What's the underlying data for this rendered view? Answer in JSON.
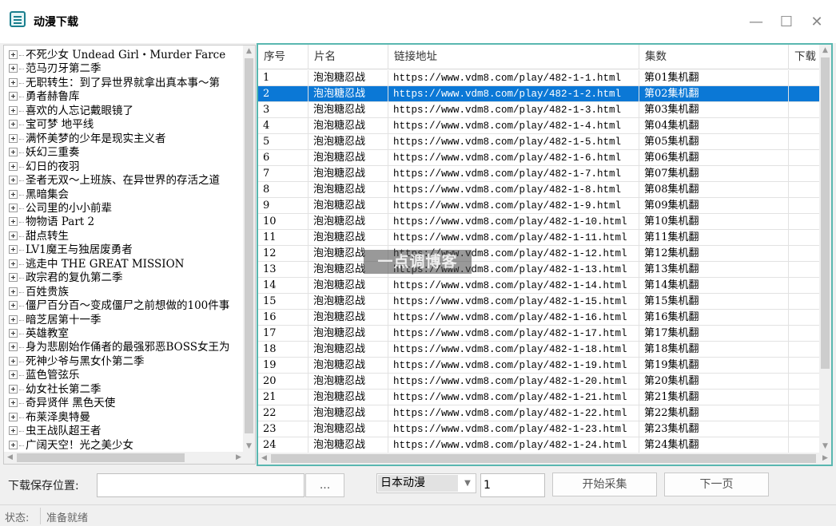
{
  "window": {
    "title": "动漫下载",
    "minimize": "—",
    "maximize": "☐",
    "close": "✕"
  },
  "tree": {
    "items": [
      "不死少女 Undead Girl・Murder Farce",
      "范马刃牙第二季",
      "无职转生：到了异世界就拿出真本事～第",
      "勇者赫鲁库",
      "喜欢的人忘记戴眼镜了",
      "宝可梦 地平线",
      "满怀美梦的少年是现实主义者",
      "妖幻三重奏",
      "幻日的夜羽",
      "圣者无双～上班族、在异世界的存活之道",
      "黑暗集会",
      "公司里的小小前辈",
      "物物语 Part 2",
      "甜点转生",
      "LV1魔王与独居废勇者",
      "逃走中 THE GREAT MISSION",
      "政宗君的复仇第二季",
      "百姓贵族",
      "僵尸百分百～变成僵尸之前想做的100件事",
      "暗芝居第十一季",
      "英雄教室",
      "身为悲剧始作俑者的最强邪恶BOSS女王为",
      "死神少爷与黑女仆第二季",
      "蓝色管弦乐",
      "幼女社长第二季",
      "奇异贤伴 黑色天使",
      "布莱泽奥特曼",
      "虫王战队超王者",
      "广阔天空！光之美少女"
    ]
  },
  "grid": {
    "headers": [
      "序号",
      "片名",
      "链接地址",
      "集数",
      "下载"
    ],
    "selected_index": 1,
    "rows": [
      [
        "1",
        "泡泡糖忍战",
        "https://www.vdm8.com/play/482-1-1.html",
        "第01集机翻",
        ""
      ],
      [
        "2",
        "泡泡糖忍战",
        "https://www.vdm8.com/play/482-1-2.html",
        "第02集机翻",
        ""
      ],
      [
        "3",
        "泡泡糖忍战",
        "https://www.vdm8.com/play/482-1-3.html",
        "第03集机翻",
        ""
      ],
      [
        "4",
        "泡泡糖忍战",
        "https://www.vdm8.com/play/482-1-4.html",
        "第04集机翻",
        ""
      ],
      [
        "5",
        "泡泡糖忍战",
        "https://www.vdm8.com/play/482-1-5.html",
        "第05集机翻",
        ""
      ],
      [
        "6",
        "泡泡糖忍战",
        "https://www.vdm8.com/play/482-1-6.html",
        "第06集机翻",
        ""
      ],
      [
        "7",
        "泡泡糖忍战",
        "https://www.vdm8.com/play/482-1-7.html",
        "第07集机翻",
        ""
      ],
      [
        "8",
        "泡泡糖忍战",
        "https://www.vdm8.com/play/482-1-8.html",
        "第08集机翻",
        ""
      ],
      [
        "9",
        "泡泡糖忍战",
        "https://www.vdm8.com/play/482-1-9.html",
        "第09集机翻",
        ""
      ],
      [
        "10",
        "泡泡糖忍战",
        "https://www.vdm8.com/play/482-1-10.html",
        "第10集机翻",
        ""
      ],
      [
        "11",
        "泡泡糖忍战",
        "https://www.vdm8.com/play/482-1-11.html",
        "第11集机翻",
        ""
      ],
      [
        "12",
        "泡泡糖忍战",
        "https://www.vdm8.com/play/482-1-12.html",
        "第12集机翻",
        ""
      ],
      [
        "13",
        "泡泡糖忍战",
        "https://www.vdm8.com/play/482-1-13.html",
        "第13集机翻",
        ""
      ],
      [
        "14",
        "泡泡糖忍战",
        "https://www.vdm8.com/play/482-1-14.html",
        "第14集机翻",
        ""
      ],
      [
        "15",
        "泡泡糖忍战",
        "https://www.vdm8.com/play/482-1-15.html",
        "第15集机翻",
        ""
      ],
      [
        "16",
        "泡泡糖忍战",
        "https://www.vdm8.com/play/482-1-16.html",
        "第16集机翻",
        ""
      ],
      [
        "17",
        "泡泡糖忍战",
        "https://www.vdm8.com/play/482-1-17.html",
        "第17集机翻",
        ""
      ],
      [
        "18",
        "泡泡糖忍战",
        "https://www.vdm8.com/play/482-1-18.html",
        "第18集机翻",
        ""
      ],
      [
        "19",
        "泡泡糖忍战",
        "https://www.vdm8.com/play/482-1-19.html",
        "第19集机翻",
        ""
      ],
      [
        "20",
        "泡泡糖忍战",
        "https://www.vdm8.com/play/482-1-20.html",
        "第20集机翻",
        ""
      ],
      [
        "21",
        "泡泡糖忍战",
        "https://www.vdm8.com/play/482-1-21.html",
        "第21集机翻",
        ""
      ],
      [
        "22",
        "泡泡糖忍战",
        "https://www.vdm8.com/play/482-1-22.html",
        "第22集机翻",
        ""
      ],
      [
        "23",
        "泡泡糖忍战",
        "https://www.vdm8.com/play/482-1-23.html",
        "第23集机翻",
        ""
      ],
      [
        "24",
        "泡泡糖忍战",
        "https://www.vdm8.com/play/482-1-24.html",
        "第24集机翻",
        ""
      ]
    ]
  },
  "watermark": "一点调博客",
  "controls": {
    "save_label": "下载保存位置:",
    "save_path": "",
    "browse_label": "...",
    "category": "日本动漫",
    "page": "1",
    "start_label": "开始采集",
    "next_label": "下一页"
  },
  "status": {
    "label": "状态:",
    "text": "准备就绪"
  },
  "colors": {
    "selection": "#0b78d6",
    "grid_border": "#59b7b0",
    "accent": "#1a7f8e"
  }
}
